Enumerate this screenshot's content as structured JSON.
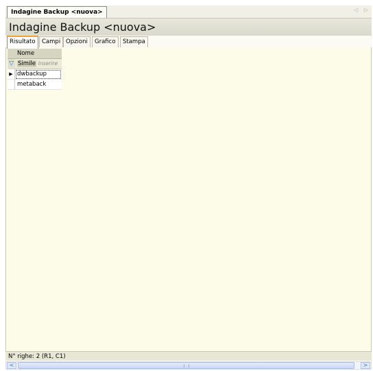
{
  "document_tab": {
    "label": "Indagine Backup <nuova>",
    "nav_glyphs": "◁ ▷"
  },
  "header": {
    "title": "Indagine Backup <nuova>"
  },
  "tabs": [
    {
      "label": "Risultato",
      "active": true
    },
    {
      "label": "Campi",
      "active": false
    },
    {
      "label": "Opzioni",
      "active": false
    },
    {
      "label": "Grafico",
      "active": false
    },
    {
      "label": "Stampa",
      "active": false
    }
  ],
  "grid": {
    "column_header": "Nome",
    "filter": {
      "operator": "Simile",
      "placeholder": "Inserire",
      "icon": "funnel-icon"
    },
    "rows": [
      {
        "indicator": "▶",
        "value": "dwbackup"
      },
      {
        "indicator": "",
        "value": "metaback"
      }
    ]
  },
  "status": {
    "text": "N° righe: 2  (R1, C1)"
  },
  "scrollbar": {
    "left_arrow": "<",
    "right_arrow": ">"
  },
  "colors": {
    "tab_accent": "#f0a23a",
    "content_bg": "#fcfce8",
    "filter_icon": "#2a6fd6"
  }
}
